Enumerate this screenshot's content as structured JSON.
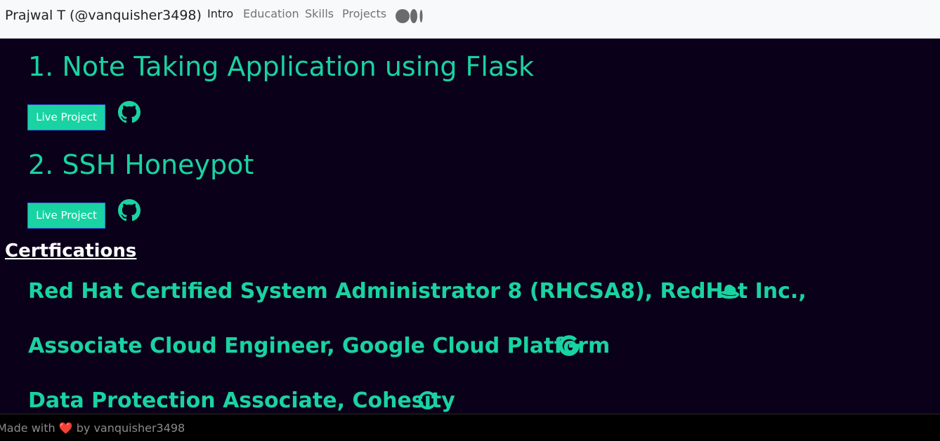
{
  "navbar": {
    "brand": "Prajwal T (@vanquisher3498)",
    "links": [
      "Intro",
      "Education",
      "Skills",
      "Projects"
    ],
    "medium_icon": "medium-icon"
  },
  "projects": [
    {
      "title": "1. Note Taking Application using Flask",
      "live_label": "Live Project",
      "repo_icon": "github-icon"
    },
    {
      "title": "2. SSH Honeypot",
      "live_label": "Live Project",
      "repo_icon": "github-icon"
    }
  ],
  "certifications": {
    "heading": "Certfications",
    "items": [
      {
        "text": "Red Hat Certified System Administrator 8 (RHCSA8), RedHat Inc.,",
        "icon": "redhat-icon"
      },
      {
        "text": "Associate Cloud Engineer, Google Cloud Platform",
        "icon": "google-icon"
      },
      {
        "text": "Data Protection Associate, Cohesity",
        "icon": "cohesity-icon"
      }
    ]
  },
  "footer": {
    "prefix": "Made with",
    "heart": "❤️",
    "suffix": "by vanquisher3498"
  },
  "colors": {
    "accent": "#19d3a2",
    "background": "#0b0019",
    "navbar_bg": "#f8f9fa",
    "footer_bg": "#000000"
  }
}
